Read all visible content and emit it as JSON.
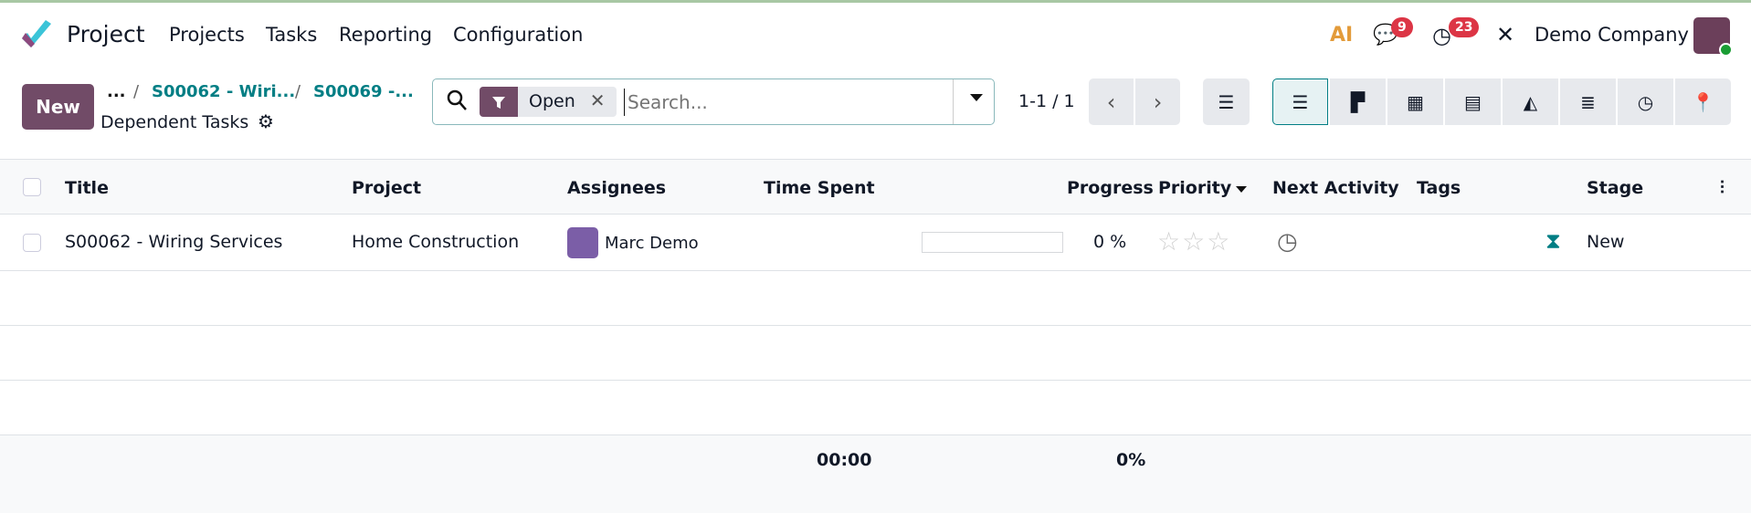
{
  "navbar": {
    "app_name": "Project",
    "menu": [
      "Projects",
      "Tasks",
      "Reporting",
      "Configuration"
    ],
    "ai_label": "AI",
    "messages_count": "9",
    "activities_count": "23",
    "company": "Demo Company"
  },
  "control": {
    "new_label": "New",
    "breadcrumbs": [
      "...",
      "S00062 - Wiri...",
      "S00069 -..."
    ],
    "page_title": "Dependent Tasks",
    "facet": "Open",
    "search_placeholder": "Search...",
    "pager": "1-1 / 1"
  },
  "table": {
    "headers": [
      "Title",
      "Project",
      "Assignees",
      "Time Spent",
      "Progress",
      "Priority",
      "Next Activity",
      "Tags",
      "Stage"
    ],
    "rows": [
      {
        "title": "S00062 - Wiring Services",
        "project": "Home Construction",
        "assignee": "Marc Demo",
        "time_spent": "",
        "progress": 0,
        "progress_label": "0 %",
        "priority_stars": 0,
        "stage": "New"
      }
    ],
    "footer": {
      "time_spent": "00:00",
      "progress": "0%"
    }
  },
  "colors": {
    "brand": "#714b67",
    "link": "#017e84",
    "badge": "#dc3545"
  }
}
